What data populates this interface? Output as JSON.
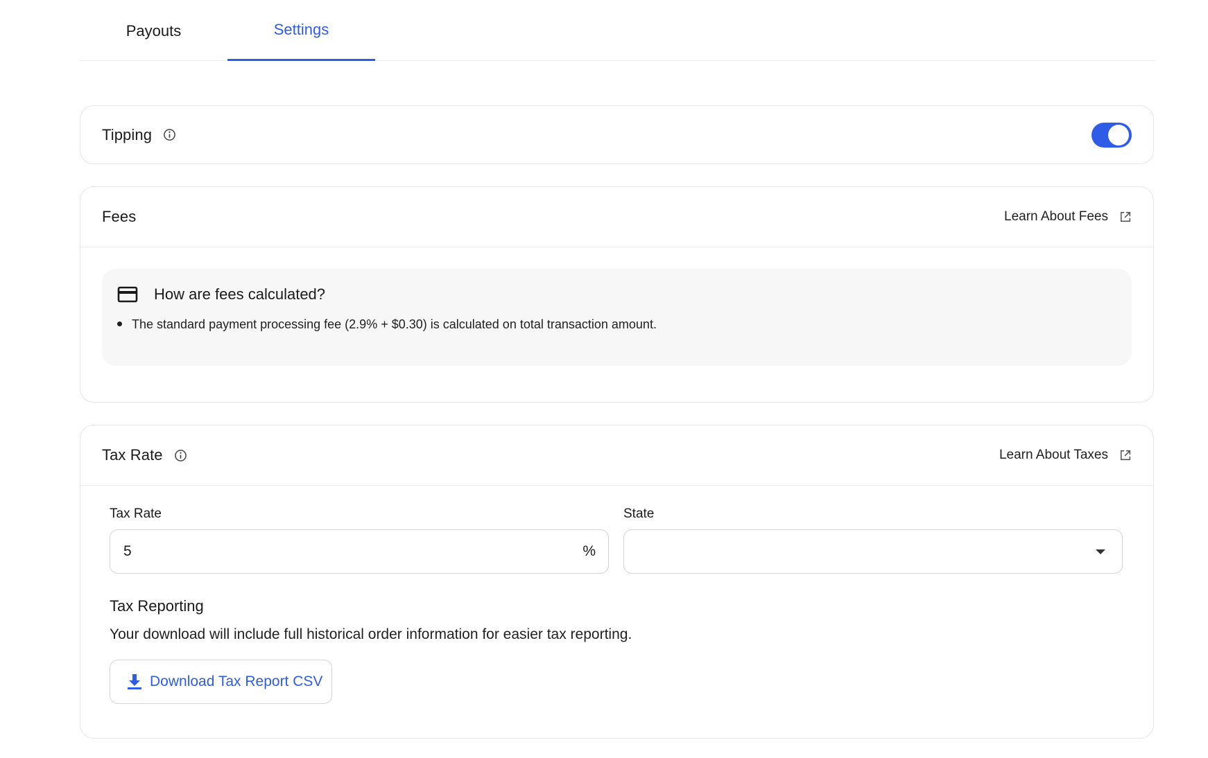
{
  "tabs": [
    {
      "label": "Payouts",
      "active": false
    },
    {
      "label": "Settings",
      "active": true
    }
  ],
  "tipping": {
    "title": "Tipping",
    "enabled": true
  },
  "fees": {
    "title": "Fees",
    "learn_link": "Learn About Fees",
    "info_title": "How are fees calculated?",
    "bullets": [
      "The standard payment processing fee (2.9% + $0.30) is calculated on total transaction amount."
    ]
  },
  "tax": {
    "title": "Tax Rate",
    "learn_link": "Learn About Taxes",
    "rate_label": "Tax Rate",
    "rate_value": "5",
    "rate_suffix": "%",
    "state_label": "State",
    "state_value": "",
    "reporting_title": "Tax Reporting",
    "reporting_desc": "Your download will include full historical order information for easier tax reporting.",
    "download_label": "Download Tax Report CSV"
  },
  "colors": {
    "accent": "#2e5ce6",
    "border": "#e6e6e6",
    "info_bg": "#f7f7f7"
  }
}
